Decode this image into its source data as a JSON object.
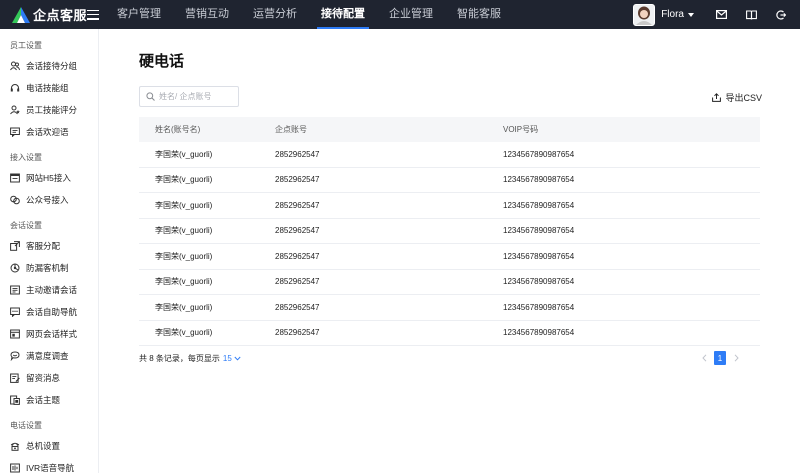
{
  "header": {
    "logo_text": "企点客服",
    "nav": [
      {
        "label": "客户管理",
        "active": false
      },
      {
        "label": "营销互动",
        "active": false
      },
      {
        "label": "运营分析",
        "active": false
      },
      {
        "label": "接待配置",
        "active": true
      },
      {
        "label": "企业管理",
        "active": false
      },
      {
        "label": "智能客服",
        "active": false
      }
    ],
    "user_name": "Flora",
    "icons": [
      "mail-icon",
      "book-icon",
      "logout-icon"
    ]
  },
  "sidebar": {
    "groups": [
      {
        "title": "员工设置",
        "items": [
          {
            "label": "会话接待分组",
            "icon": "people-icon"
          },
          {
            "label": "电话技能组",
            "icon": "headset-icon"
          },
          {
            "label": "员工技能评分",
            "icon": "user-star-icon"
          },
          {
            "label": "会话欢迎语",
            "icon": "chat-icon"
          }
        ]
      },
      {
        "title": "接入设置",
        "items": [
          {
            "label": "网站H5接入",
            "icon": "browser-icon"
          },
          {
            "label": "公众号接入",
            "icon": "link-icon"
          }
        ]
      },
      {
        "title": "会话设置",
        "items": [
          {
            "label": "客服分配",
            "icon": "assign-icon"
          },
          {
            "label": "防漏客机制",
            "icon": "shield-icon"
          },
          {
            "label": "主动邀请会话",
            "icon": "invite-icon"
          },
          {
            "label": "会话自助导航",
            "icon": "navigation-icon"
          },
          {
            "label": "网页会话样式",
            "icon": "webpage-icon"
          },
          {
            "label": "满意度调查",
            "icon": "satisfaction-icon"
          },
          {
            "label": "留资消息",
            "icon": "form-icon"
          },
          {
            "label": "会话主题",
            "icon": "topic-icon"
          }
        ]
      },
      {
        "title": "电话设置",
        "items": [
          {
            "label": "总机设置",
            "icon": "phone-icon"
          },
          {
            "label": "IVR语音导航",
            "icon": "ivr-icon"
          }
        ]
      }
    ]
  },
  "main": {
    "title": "硬电话",
    "search_placeholder": "姓名/ 企点账号",
    "export_label": "导出CSV",
    "columns": [
      "姓名(账号名)",
      "企点账号",
      "VOIP号码"
    ],
    "rows": [
      [
        "李国荣(v_guorli)",
        "2852962547",
        "1234567890987654"
      ],
      [
        "李国荣(v_guorli)",
        "2852962547",
        "1234567890987654"
      ],
      [
        "李国荣(v_guorli)",
        "2852962547",
        "1234567890987654"
      ],
      [
        "李国荣(v_guorli)",
        "2852962547",
        "1234567890987654"
      ],
      [
        "李国荣(v_guorli)",
        "2852962547",
        "1234567890987654"
      ],
      [
        "李国荣(v_guorli)",
        "2852962547",
        "1234567890987654"
      ],
      [
        "李国荣(v_guorli)",
        "2852962547",
        "1234567890987654"
      ],
      [
        "李国荣(v_guorli)",
        "2852962547",
        "1234567890987654"
      ]
    ],
    "footer": {
      "total_text": "共 8 条记录，每页显示",
      "page_size": "15",
      "current_page": "1"
    }
  },
  "colors": {
    "topbar": "#1f2430",
    "accent": "#2e7cf6",
    "table_header_bg": "#f5f6f8"
  }
}
